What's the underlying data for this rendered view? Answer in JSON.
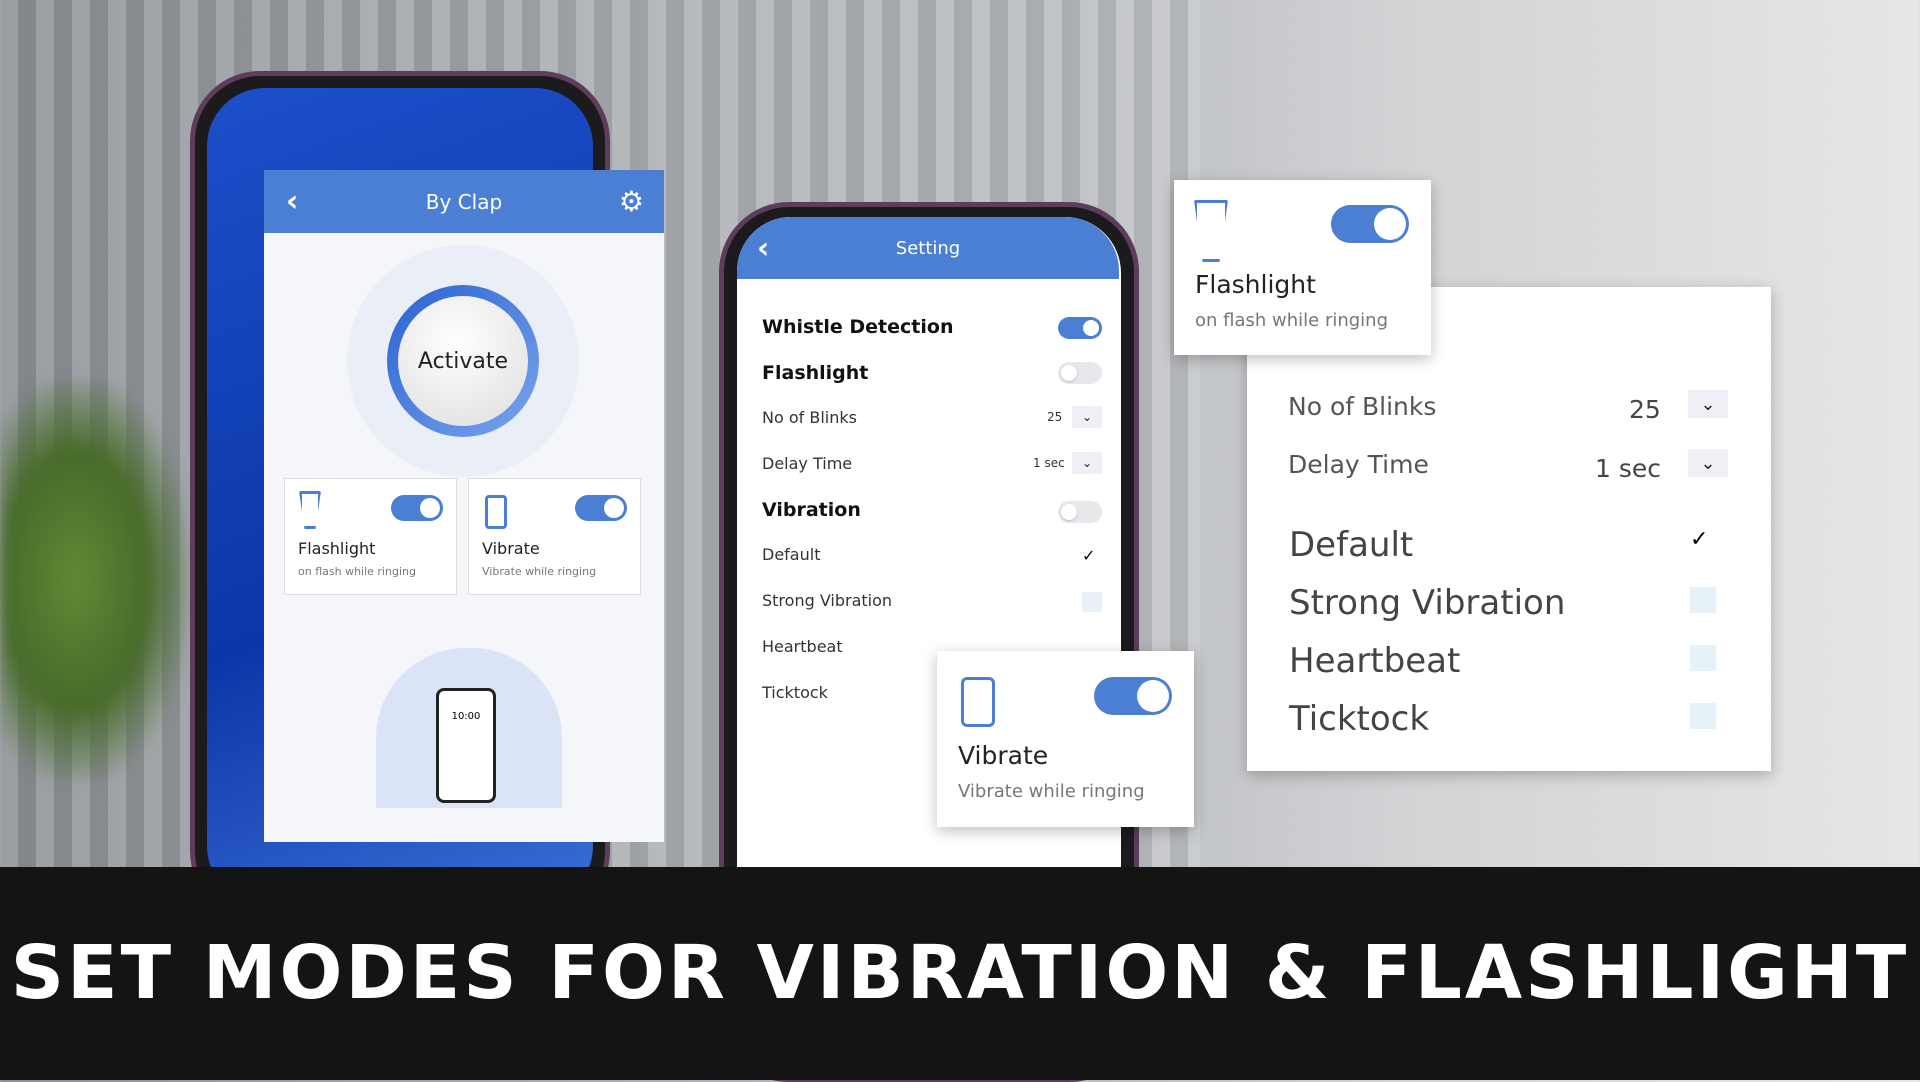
{
  "banner": {
    "text": "SET MODES FOR VIBRATION & FLASHLIGHT"
  },
  "by_clap": {
    "title": "By Clap",
    "activate": "Activate",
    "flashlight": {
      "title": "Flashlight",
      "subtitle": "on flash while ringing",
      "enabled": true
    },
    "vibrate": {
      "title": "Vibrate",
      "subtitle": "Vibrate while ringing",
      "enabled": true
    },
    "illustration_time": "10:00"
  },
  "setting": {
    "title": "Setting",
    "whistle": {
      "label": "Whistle Detection",
      "enabled": true
    },
    "flashlight": {
      "label": "Flashlight",
      "enabled": false
    },
    "blinks": {
      "label": "No of Blinks",
      "value": "25"
    },
    "delay": {
      "label": "Delay Time",
      "value": "1 sec"
    },
    "vibration": {
      "label": "Vibration",
      "enabled": false
    },
    "modes": [
      {
        "label": "Default",
        "checked": true
      },
      {
        "label": "Strong Vibration",
        "checked": false
      },
      {
        "label": "Heartbeat",
        "checked": false
      },
      {
        "label": "Ticktock",
        "checked": false
      }
    ]
  },
  "popup_flash": {
    "title": "Flashlight",
    "subtitle": "on flash while ringing",
    "enabled": true
  },
  "popup_vibrate": {
    "title": "Vibrate",
    "subtitle": "Vibrate while ringing",
    "enabled": true
  },
  "colors": {
    "accent": "#4a7fd4",
    "banner": "#141414"
  }
}
